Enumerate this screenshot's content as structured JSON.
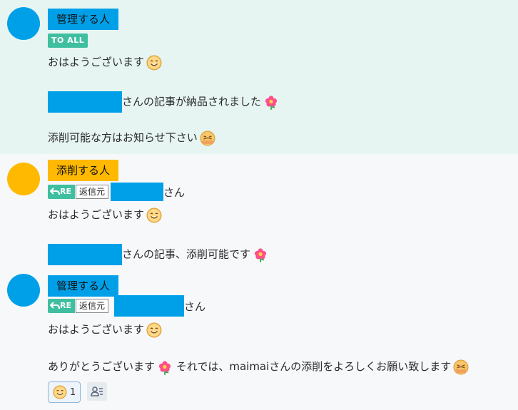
{
  "messages": [
    {
      "sender": "管理する人",
      "badge": "TO ALL",
      "lines": [
        "おはようございます",
        "さんの記事が納品されました",
        "添削可能な方はお知らせ下さい"
      ]
    },
    {
      "sender": "添削する人",
      "reply_badge": "RE",
      "reply_source": "返信元",
      "reply_to_suffix": "さん",
      "lines": [
        "おはようございます",
        "さんの記事、添削可能です"
      ]
    },
    {
      "sender": "管理する人",
      "reply_badge": "RE",
      "reply_source": "返信元",
      "reply_to_suffix": "さん",
      "lines": [
        "おはようございます",
        "ありがとうございます",
        "それでは、maimaiさんの添削をよろしくお願い致します"
      ],
      "reaction_count": "1"
    }
  ],
  "colors": {
    "manager_avatar": "#00a0e9",
    "editor_avatar": "#ffb900",
    "manager_name_bg": "#00a0e9",
    "editor_name_bg": "#ffb900",
    "redaction": "#00a0e9",
    "badge": "#3fbfa0"
  },
  "icons": [
    "smile-emoji-icon",
    "flower-emoji-icon",
    "exhausted-emoji-icon",
    "reply-arrow-icon",
    "member-list-icon"
  ]
}
